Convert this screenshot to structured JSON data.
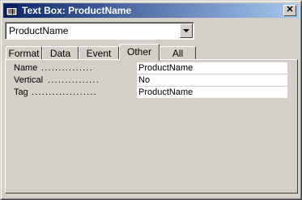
{
  "window": {
    "title": "Text Box: ProductName",
    "close_glyph": "✕"
  },
  "object_selector": {
    "value": "ProductName"
  },
  "tabs": [
    {
      "label": "Format",
      "active": false
    },
    {
      "label": "Data",
      "active": false
    },
    {
      "label": "Event",
      "active": false
    },
    {
      "label": "Other",
      "active": true
    },
    {
      "label": "All",
      "active": false
    }
  ],
  "properties": [
    {
      "label": "Name",
      "dots": "...............",
      "value": "ProductName"
    },
    {
      "label": "Vertical",
      "dots": "...............",
      "value": "No"
    },
    {
      "label": "Tag",
      "dots": "...................",
      "value": "ProductName"
    }
  ],
  "colors": {
    "face": "#d4d0c8",
    "title_start": "#0a246a",
    "title_end": "#a6caf0"
  }
}
